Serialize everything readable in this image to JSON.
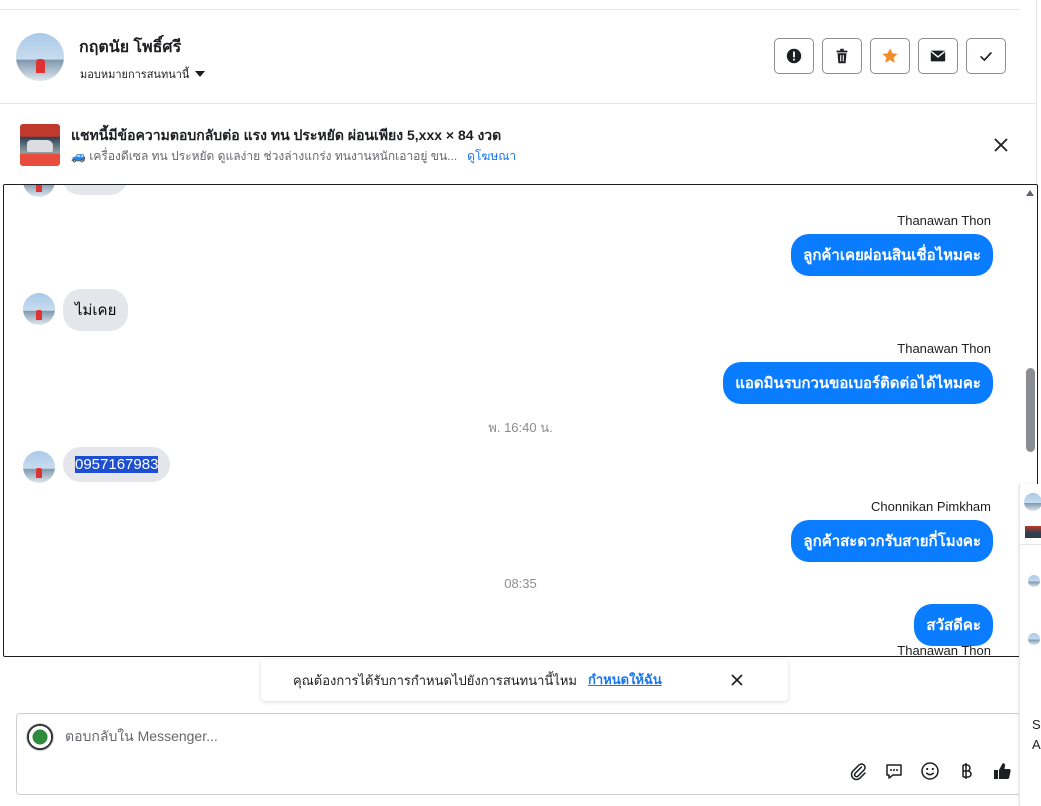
{
  "header": {
    "contact_name": "กฤตนัย โพธิ์ศรี",
    "assign_label": "มอบหมายการสนทนานี้",
    "actions": [
      {
        "icon": "alert-icon",
        "name": "report-button"
      },
      {
        "icon": "trash-icon",
        "name": "delete-button"
      },
      {
        "icon": "star-icon",
        "name": "star-button"
      },
      {
        "icon": "envelope-icon",
        "name": "mark-unread-button"
      },
      {
        "icon": "check-icon",
        "name": "mark-done-button"
      }
    ],
    "star_color": "#f28c28"
  },
  "ad": {
    "title": "แชทนี้มีข้อความตอบกลับต่อ แรง ทน ประหยัด ผ่อนเพียง 5,xxx × 84 งวด",
    "subtitle": "🚙 เครื่องดีเซล ทน ประหยัด ดูแลง่าย ช่วงล่างแกร่ง ทนงานหนักเอาอยู่ ขน...",
    "link": "ดูโฆษณา"
  },
  "messages": {
    "items": [
      {
        "type": "out",
        "sender": "Thanawan Thon",
        "text": "ลูกค้าเคยผ่อนสินเชื่อไหมคะ"
      },
      {
        "type": "in",
        "text": "ไม่เคย"
      },
      {
        "type": "out",
        "sender": "Thanawan Thon",
        "text": "แอดมินรบกวนขอเบอร์ติดต่อได้ไหมคะ"
      },
      {
        "type": "time",
        "text": "พ. 16:40 น."
      },
      {
        "type": "in",
        "text": "0957167983"
      },
      {
        "type": "out",
        "sender": "Chonnikan Pimkham",
        "text": "ลูกค้าสะดวกรับสายกี่โมงคะ"
      },
      {
        "type": "time",
        "text": "08:35"
      },
      {
        "type": "out",
        "sender": "Thanawan Thon",
        "text": "สวัสดีคะ"
      }
    ],
    "outgoing_color": "#0a7cff",
    "incoming_color": "#e4e6eb"
  },
  "reminder": {
    "text": "คุณต้องการได้รับการกำหนดไปยังการสนทนานี้ไหม",
    "link": "กำหนดให้ฉัน"
  },
  "composer": {
    "placeholder": "ตอบกลับใน Messenger...",
    "tools": [
      "paperclip-icon",
      "chat-bubble-icon",
      "emoji-icon",
      "baht-icon",
      "thumbs-up-icon"
    ]
  },
  "side_panel": {
    "letter_s": "S",
    "letter_a": "A"
  }
}
